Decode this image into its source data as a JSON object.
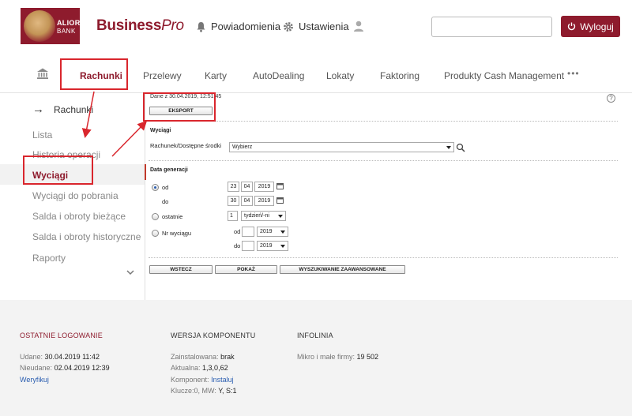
{
  "header": {
    "logo": {
      "line1": "ALIOR",
      "line2": "BANK"
    },
    "brand": {
      "main": "Business",
      "pro": "Pro"
    },
    "notifications_label": "Powiadomienia",
    "settings_label": "Ustawienia",
    "user_icon": "user-icon",
    "search_value": "",
    "logout_label": "Wyloguj"
  },
  "mainnav": {
    "home_icon": "bank-icon",
    "items": [
      "Rachunki",
      "Przelewy",
      "Karty",
      "AutoDealing",
      "Lokaty",
      "Faktoring",
      "Produkty Cash Management",
      "•••"
    ],
    "active": "Rachunki"
  },
  "sidebar": {
    "head": "Rachunki",
    "items": [
      "Lista",
      "Historia operacji",
      "Wyciągi",
      "Wyciągi do pobrania",
      "Salda i obroty bieżące",
      "Salda i obroty historyczne",
      "Raporty"
    ],
    "active": "Wyciągi"
  },
  "content": {
    "date_text": "Dane z 30.04.2019, 12:51:45",
    "export_label": "EKSPORT",
    "section_statements": "Wyciągi",
    "account_label": "Rachunek/Dostępne środki",
    "account_select": "Wybierz",
    "section_generation": "Data generacji",
    "od_label": "od",
    "do_label": "do",
    "od_day": "23",
    "od_month": "04",
    "od_year": "2019",
    "do_day": "30",
    "do_month": "04",
    "do_year": "2019",
    "last_label": "ostatnie",
    "last_count": "1",
    "last_unit": "tydzień/-ni",
    "nr_label": "Nr wyciągu",
    "nr_od_label": "od",
    "nr_do_label": "do",
    "nr_od_value": "",
    "nr_do_value": "",
    "nr_od_year": "2019",
    "nr_do_year": "2019",
    "back_label": "WSTECZ",
    "show_label": "POKAŻ",
    "advanced_label": "WYSZUKIWANIE ZAAWANSOWANE"
  },
  "footer": {
    "last_login": {
      "title": "OSTATNIE LOGOWANIE",
      "success_label": "Udane:",
      "success_value": "30.04.2019 11:42",
      "failed_label": "Nieudane:",
      "failed_value": "02.04.2019 12:39",
      "verify_link": "Weryfikuj"
    },
    "component": {
      "title": "WERSJA KOMPONENTU",
      "installed_label": "Zainstalowana:",
      "installed_value": "brak",
      "current_label": "Aktualna:",
      "current_value": "1,3,0,62",
      "component_label": "Komponent:",
      "component_link": "Instaluj",
      "keys_label": "Klucze:0, MW:",
      "keys_value": "Y, S:1"
    },
    "infoline": {
      "title": "INFOLINIA",
      "label": "Mikro i małe firmy:",
      "value": "19 502"
    }
  },
  "colors": {
    "brand": "#8e1b2d",
    "annotation": "#d9262d",
    "link": "#2a5db0"
  }
}
